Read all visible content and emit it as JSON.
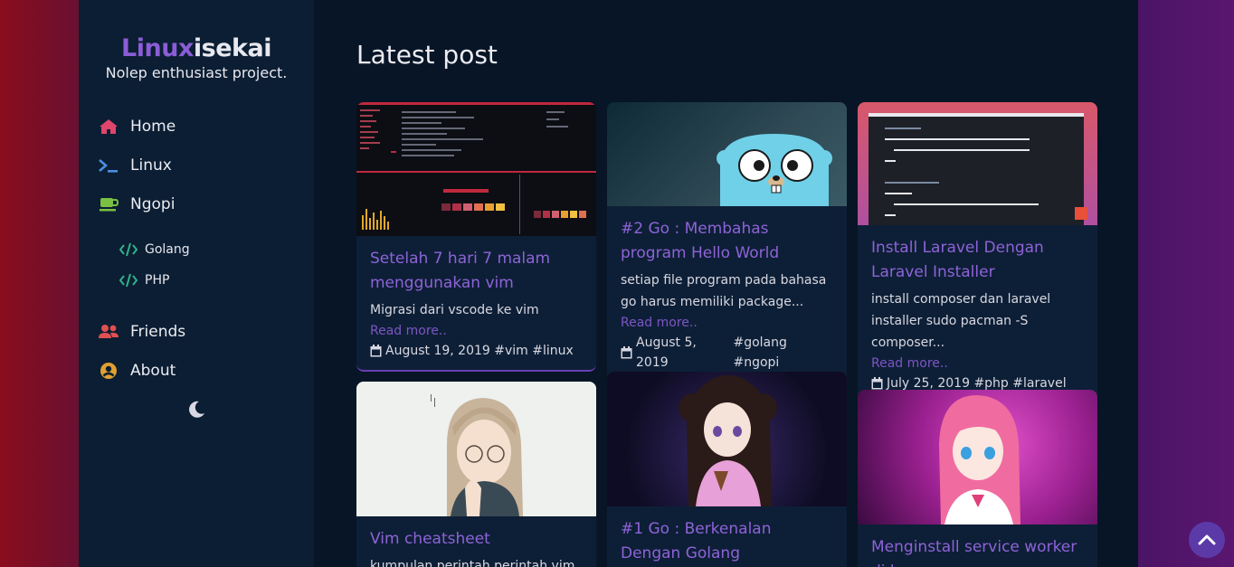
{
  "brand": {
    "title_part1": "Linux",
    "title_part2": "isekai",
    "subtitle": "Nolep enthusiast project."
  },
  "nav": {
    "items": [
      {
        "label": "Home",
        "icon": "home-icon",
        "color": "#e0456b"
      },
      {
        "label": "Linux",
        "icon": "terminal-icon",
        "color": "#4a8fe0"
      },
      {
        "label": "Ngopi",
        "icon": "coffee-icon",
        "color": "#7ac142"
      }
    ],
    "sub_items": [
      {
        "label": "Golang",
        "icon": "code-icon",
        "color": "#2fb38a"
      },
      {
        "label": "PHP",
        "icon": "code-icon",
        "color": "#2fb38a"
      }
    ],
    "bottom_items": [
      {
        "label": "Friends",
        "icon": "users-icon",
        "color": "#e05050"
      },
      {
        "label": "About",
        "icon": "user-circle-icon",
        "color": "#e0a030"
      }
    ]
  },
  "theme_toggle": {
    "icon": "moon-icon"
  },
  "main": {
    "title": "Latest post",
    "posts": [
      {
        "title": "Setelah 7 hari 7 malam menggunakan vim",
        "description": "Migrasi dari vscode ke vim",
        "read_more": "Read more..",
        "date": "August 19, 2019",
        "tags": "#vim #linux"
      },
      {
        "title": "#2 Go : Membahas program Hello World",
        "description": "setiap file program pada bahasa go harus memiliki package...",
        "read_more": "Read more..",
        "date": "August 5, 2019",
        "tags": "#golang #ngopi"
      },
      {
        "title": "Install Laravel Dengan Laravel Installer",
        "description": "install composer dan laravel installer sudo pacman -S composer...",
        "read_more": "Read more..",
        "date": "July 25, 2019",
        "tags": "#php #laravel"
      },
      {
        "title": "Vim cheatsheet",
        "description": "kumpulan perintah perintah vim"
      },
      {
        "title": "#1 Go : Berkenalan Dengan Golang"
      },
      {
        "title": "Menginstall service worker di hugo"
      }
    ]
  },
  "colors": {
    "accent": "#8e63d8",
    "sidebar_bg": "#0b1e33",
    "main_bg": "#081526"
  }
}
